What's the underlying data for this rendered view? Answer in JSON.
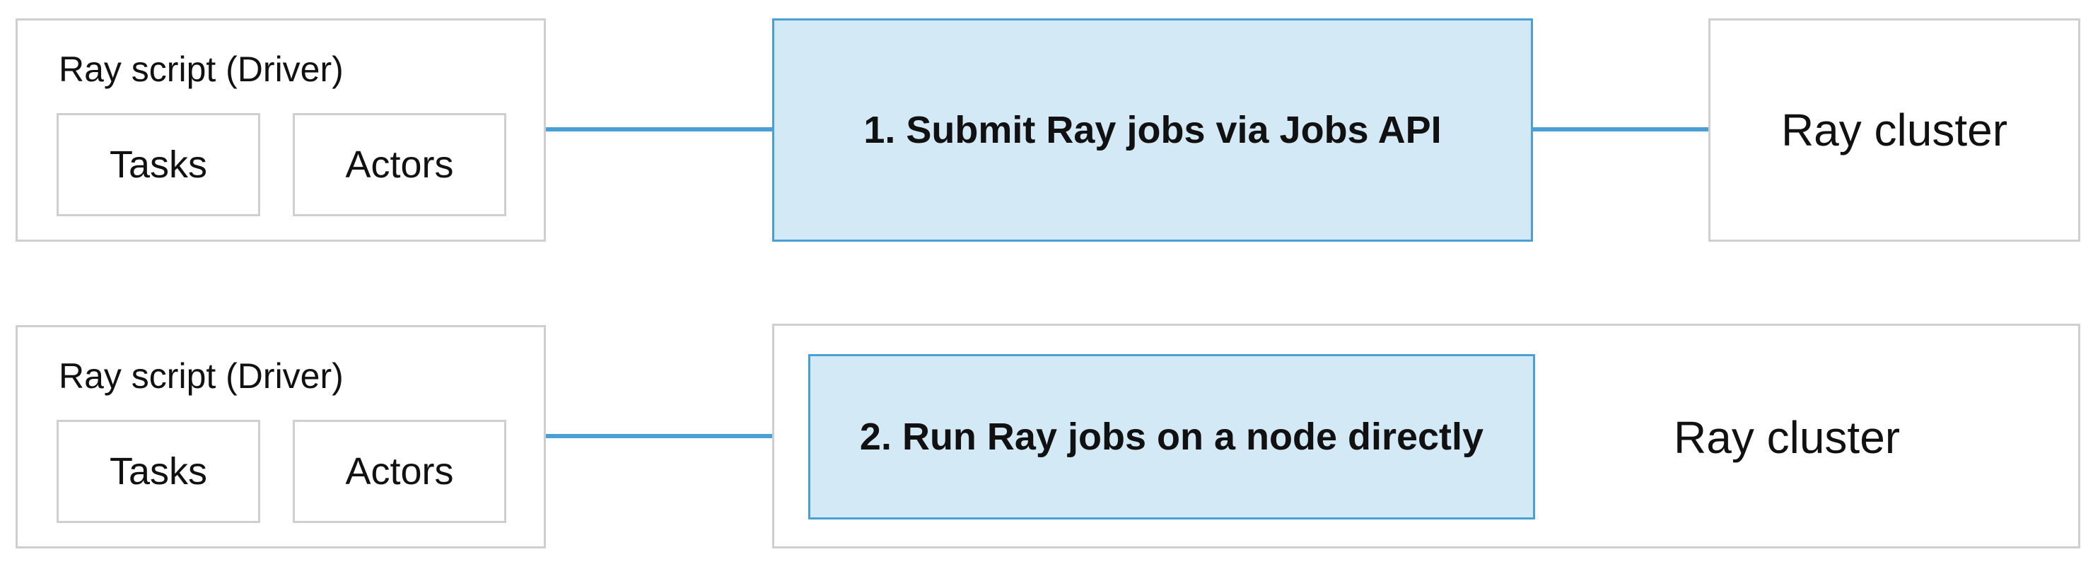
{
  "row1": {
    "driver": {
      "title": "Ray script (Driver)",
      "tasks": "Tasks",
      "actors": "Actors"
    },
    "step": "1. Submit Ray jobs via Jobs API",
    "cluster": "Ray cluster"
  },
  "row2": {
    "driver": {
      "title": "Ray script (Driver)",
      "tasks": "Tasks",
      "actors": "Actors"
    },
    "step": "2. Run Ray jobs on a node directly",
    "cluster": "Ray cluster"
  },
  "colors": {
    "connector": "#4a9fd6",
    "highlight_fill": "#d4e9f6",
    "box_border": "#cfcfcf"
  }
}
